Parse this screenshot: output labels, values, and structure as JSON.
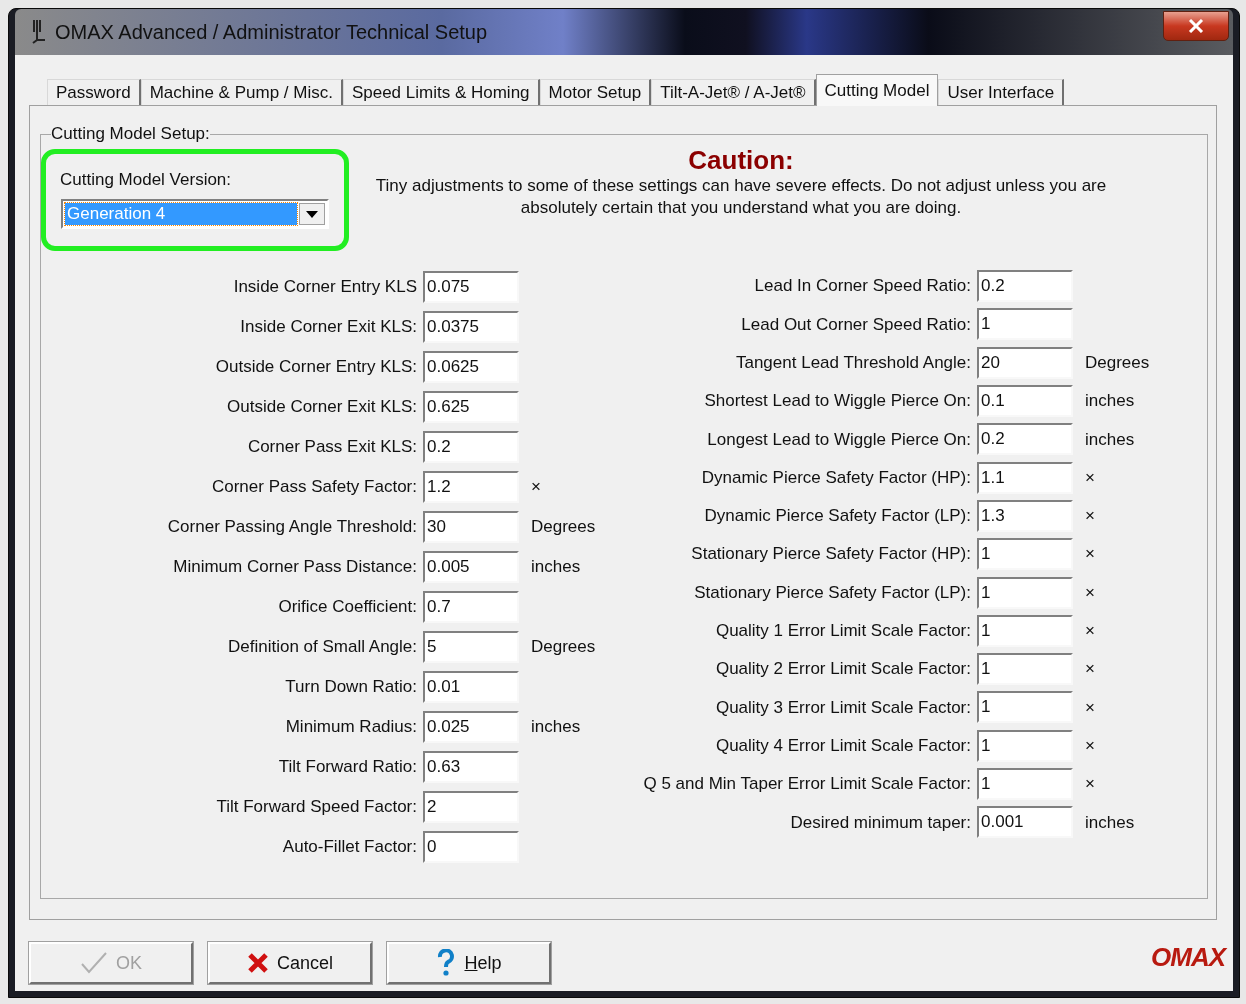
{
  "window": {
    "title": "OMAX Advanced / Administrator Technical Setup"
  },
  "tabs": [
    {
      "label": "Password",
      "selected": false
    },
    {
      "label": "Machine & Pump / Misc.",
      "selected": false
    },
    {
      "label": "Speed Limits & Homing",
      "selected": false
    },
    {
      "label": "Motor Setup",
      "selected": false
    },
    {
      "label": "Tilt-A-Jet® / A-Jet®",
      "selected": false
    },
    {
      "label": "Cutting Model",
      "selected": true
    },
    {
      "label": "User Interface",
      "selected": false
    }
  ],
  "group": {
    "title": "Cutting Model Setup:"
  },
  "version": {
    "label": "Cutting Model Version:",
    "value": "Generation 4"
  },
  "caution": {
    "title": "Caution:",
    "text": "Tiny adjustments to some of these settings can have severe effects.  Do not adjust unless you are absolutely certain that you understand what you are doing."
  },
  "left_fields": [
    {
      "label": "Inside Corner Entry KLS",
      "value": "0.075"
    },
    {
      "label": "Inside Corner Exit KLS:",
      "value": "0.0375"
    },
    {
      "label": "Outside Corner Entry KLS:",
      "value": "0.0625"
    },
    {
      "label": "Outside Corner Exit KLS:",
      "value": "0.625"
    },
    {
      "label": "Corner Pass Exit KLS:",
      "value": "0.2"
    },
    {
      "label": "Corner Pass Safety Factor:",
      "value": "1.2",
      "unit": "×"
    },
    {
      "label": "Corner Passing Angle Threshold:",
      "value": "30",
      "unit": "Degrees"
    },
    {
      "label": "Minimum Corner Pass Distance:",
      "value": "0.005",
      "unit": "inches"
    },
    {
      "label": "Orifice Coefficient:",
      "value": "0.7"
    },
    {
      "label": "Definition of Small Angle:",
      "value": "5",
      "unit": "Degrees"
    },
    {
      "label": "Turn Down Ratio:",
      "value": "0.01"
    },
    {
      "label": "Minimum Radius:",
      "value": "0.025",
      "unit": "inches"
    },
    {
      "label": "Tilt Forward Ratio:",
      "value": "0.63"
    },
    {
      "label": "Tilt Forward Speed Factor:",
      "value": "2"
    },
    {
      "label": "Auto-Fillet Factor:",
      "value": "0"
    }
  ],
  "right_fields": [
    {
      "label": "Lead In Corner Speed Ratio:",
      "value": "0.2"
    },
    {
      "label": "Lead Out Corner Speed Ratio:",
      "value": "1"
    },
    {
      "label": "Tangent Lead Threshold Angle:",
      "value": "20",
      "unit": "Degrees"
    },
    {
      "label": "Shortest Lead to Wiggle Pierce On:",
      "value": "0.1",
      "unit": "inches"
    },
    {
      "label": "Longest Lead to Wiggle Pierce On:",
      "value": "0.2",
      "unit": "inches"
    },
    {
      "label": "Dynamic Pierce Safety Factor (HP):",
      "value": "1.1",
      "unit": "×"
    },
    {
      "label": "Dynamic Pierce Safety Factor (LP):",
      "value": "1.3",
      "unit": "×"
    },
    {
      "label": "Stationary Pierce Safety Factor (HP):",
      "value": "1",
      "unit": "×"
    },
    {
      "label": "Stationary Pierce Safety Factor (LP):",
      "value": "1",
      "unit": "×"
    },
    {
      "label": "Quality 1 Error Limit Scale Factor:",
      "value": "1",
      "unit": "×"
    },
    {
      "label": "Quality 2 Error Limit Scale Factor:",
      "value": "1",
      "unit": "×"
    },
    {
      "label": "Quality 3 Error Limit Scale Factor:",
      "value": "1",
      "unit": "×"
    },
    {
      "label": "Quality 4 Error Limit Scale Factor:",
      "value": "1",
      "unit": "×"
    },
    {
      "label": "Q 5 and Min Taper Error Limit Scale Factor:",
      "value": "1",
      "unit": "×"
    },
    {
      "label": "Desired minimum taper:",
      "value": "0.001",
      "unit": "inches"
    }
  ],
  "buttons": [
    {
      "kind": "ok",
      "label": "OK",
      "disabled": true
    },
    {
      "kind": "cancel",
      "label": "Cancel",
      "disabled": false
    },
    {
      "kind": "help",
      "label": "Help",
      "disabled": false
    }
  ],
  "logo": "OMAX"
}
